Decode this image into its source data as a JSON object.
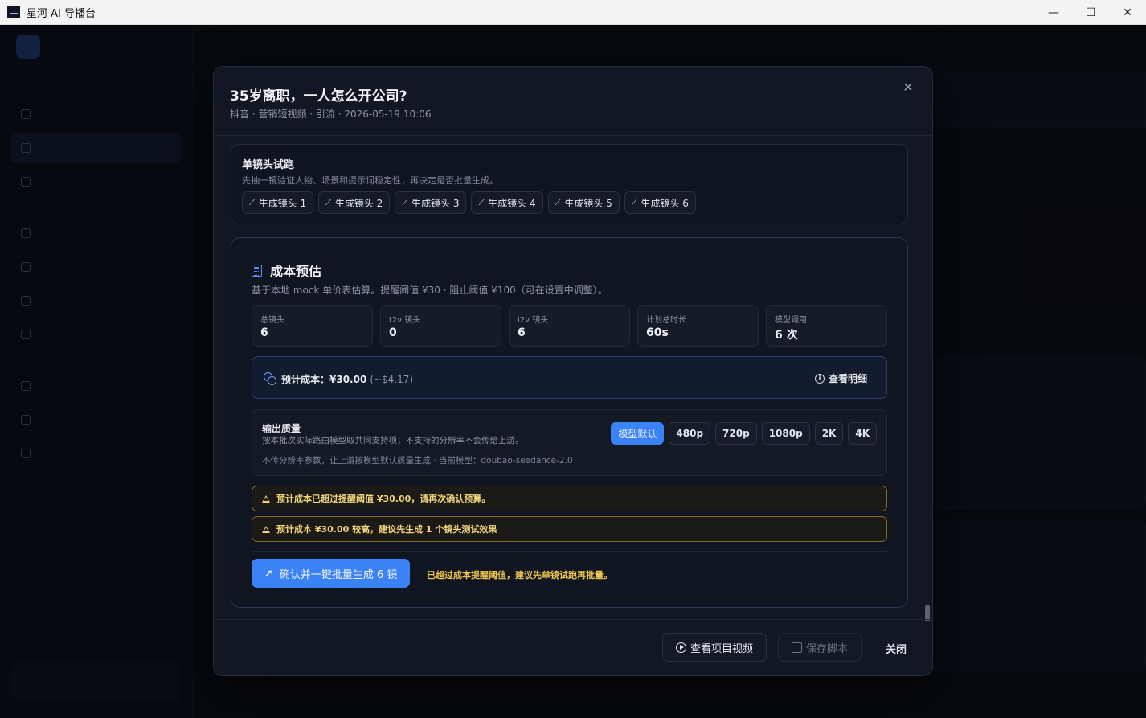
{
  "window": {
    "title": "星河 AI 导播台",
    "minimize": "—",
    "maximize": "☐",
    "close": "✕"
  },
  "modal": {
    "title": "35岁离职，一人怎么开公司?",
    "subtitle": "抖音 · 营销短视频 · 引流 · 2026-05-19 10:06",
    "close_glyph": "✕"
  },
  "trial": {
    "title": "单镜头试跑",
    "desc": "先抽一镜验证人物、场景和提示词稳定性，再决定是否批量生成。",
    "shots": [
      "生成镜头 1",
      "生成镜头 2",
      "生成镜头 3",
      "生成镜头 4",
      "生成镜头 5",
      "生成镜头 6"
    ],
    "shot_icon": "magic-wand-icon"
  },
  "cost": {
    "title": "成本预估",
    "desc": "基于本地 mock 单价表估算。提醒阈值 ¥30 · 阻止阈值 ¥100（可在设置中调整）。",
    "stats": [
      {
        "label": "总镜头",
        "value": "6"
      },
      {
        "label": "t2v 镜头",
        "value": "0"
      },
      {
        "label": "i2v 镜头",
        "value": "6"
      },
      {
        "label": "计划总时长",
        "value": "60s"
      },
      {
        "label": "模型调用",
        "value": "6 次"
      }
    ],
    "estimate_label": "预计成本：¥30.00",
    "estimate_usd": "(~$4.17)",
    "detail_link": "查看明细",
    "quality": {
      "title": "输出质量",
      "desc": "按本批次实际路由模型取共同支持项；不支持的分辨率不会传给上游。",
      "note": "不传分辨率参数，让上游按模型默认质量生成 · 当前模型：doubao-seedance-2.0",
      "options": [
        "模型默认",
        "480p",
        "720p",
        "1080p",
        "2K",
        "4K"
      ],
      "selected": "模型默认"
    },
    "warnings": [
      "预计成本已超过提醒阈值 ¥30.00，请再次确认预算。",
      "预计成本 ¥30.00 较高，建议先生成 1 个镜头测试效果"
    ],
    "confirm_button": "确认并一键批量生成 6 镜",
    "confirm_hint": "已超过成本提醒阈值，建议先单镜试跑再批量。"
  },
  "footer": {
    "view_video": "查看项目视频",
    "save_script": "保存脚本",
    "close": "关闭"
  },
  "colors": {
    "accent": "#3b82f6",
    "warning": "#f1d57a",
    "modal_bg": "#111723"
  }
}
